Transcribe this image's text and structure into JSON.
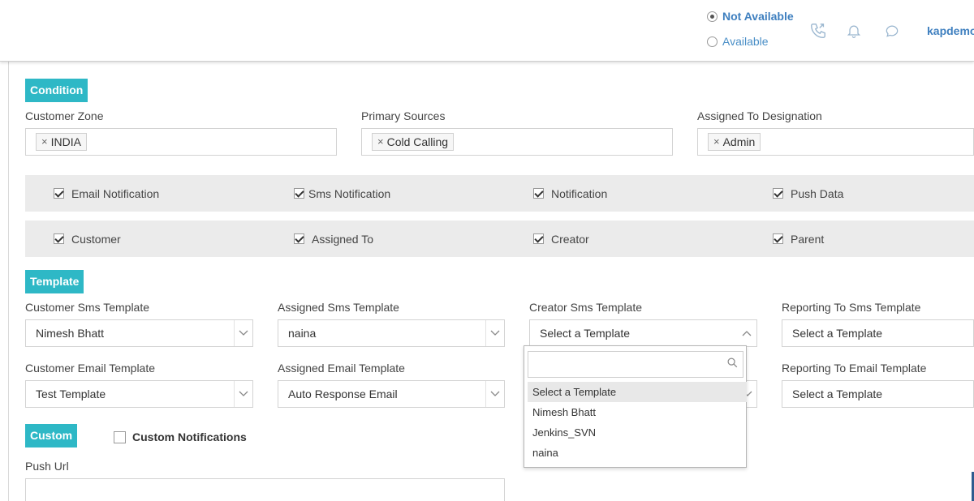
{
  "header": {
    "status_options": [
      {
        "label": "Not Available",
        "selected": true
      },
      {
        "label": "Available",
        "selected": false
      }
    ],
    "icons": [
      "phone-icon",
      "bell-icon",
      "chat-icon"
    ],
    "user_name": "kapdemo"
  },
  "condition": {
    "tag": "Condition",
    "fields": [
      {
        "label": "Customer Zone",
        "chip": "INDIA"
      },
      {
        "label": "Primary Sources",
        "chip": "Cold Calling"
      },
      {
        "label": "Assigned To Designation",
        "chip": "Admin"
      }
    ]
  },
  "notification_checks": [
    {
      "label": "Email Notification",
      "checked": true
    },
    {
      "label": "Sms Notification",
      "checked": true
    },
    {
      "label": "Notification",
      "checked": true
    },
    {
      "label": "Push Data",
      "checked": true
    }
  ],
  "recipient_checks": [
    {
      "label": "Customer",
      "checked": true
    },
    {
      "label": "Assigned To",
      "checked": true
    },
    {
      "label": "Creator",
      "checked": true
    },
    {
      "label": "Parent",
      "checked": true
    }
  ],
  "template": {
    "tag": "Template",
    "sms": [
      {
        "label": "Customer Sms Template",
        "value": "Nimesh Bhatt"
      },
      {
        "label": "Assigned Sms Template",
        "value": "naina"
      },
      {
        "label": "Creator Sms Template",
        "value": "Select a Template"
      },
      {
        "label": "Reporting To Sms Template",
        "value": "Select a Template"
      }
    ],
    "email": [
      {
        "label": "Customer Email Template",
        "value": "Test Template"
      },
      {
        "label": "Assigned Email Template",
        "value": "Auto Response Email"
      },
      {
        "label": "Reporting To Email Template",
        "value": "Select a Template"
      }
    ],
    "dropdown": {
      "search_placeholder": "",
      "options": [
        "Select a Template",
        "Nimesh Bhatt",
        "Jenkins_SVN",
        "naina"
      ],
      "highlighted": 0
    }
  },
  "custom": {
    "tag": "Custom",
    "checkbox_label": "Custom Notifications",
    "push_url_label": "Push Url"
  }
}
